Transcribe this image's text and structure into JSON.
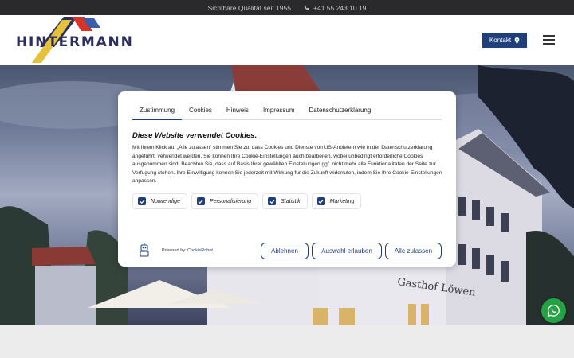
{
  "topbar": {
    "tagline": "Sichtbare Qualität seit 1955",
    "phone": "+41 55 243 10 19"
  },
  "header": {
    "logo_text": "HINTERMANN",
    "kontakt_label": "Kontakt"
  },
  "consent": {
    "tabs": [
      {
        "label": "Zustimmung"
      },
      {
        "label": "Cookies"
      },
      {
        "label": "Hinweis"
      },
      {
        "label": "Impressum"
      },
      {
        "label": "Datenschutzerklarung"
      }
    ],
    "title": "Diese Website verwendet Cookies.",
    "body": "Mit Ihrem Klick auf „Alle zulassen“ stimmen Sie zu, dass Cookies und Dienste von US-Anbietern wie in der Datenschutzerklarung angeführt, verwendet werden. Sie konnen Ihre Cookie-Einstellungen auch bearbeiten, wobei unbedingt erforderliche Cookies ausgenommen sind. Beachten Sie, dass auf Basis Ihrer gewählten Einstellungen ggf. nicht mehr alle Funktionalitaten der Seite zur Verfugung stehen. Ihre Einwilligung konnen Sie jederzeit mit Wirkung fur die Zukunft widerrufen, indem Sie Ihre Cookie-Einstellungen anpassen.",
    "checkboxes": [
      {
        "label": "Notwendige",
        "checked": true
      },
      {
        "label": "Personalisierung",
        "checked": true
      },
      {
        "label": "Statistik",
        "checked": true
      },
      {
        "label": "Marketing",
        "checked": true
      }
    ],
    "powered_by": "Powered by:",
    "powered_link": "CookieRobot",
    "buttons": {
      "reject": "Ablehnen",
      "allow_selection": "Auswahl erlauben",
      "allow_all": "Alle zulassen"
    }
  },
  "colors": {
    "accent": "#1e3f7a",
    "topbar_bg": "#2a2a2c",
    "whatsapp": "#25a244"
  },
  "icons": [
    "phone-icon",
    "location-pin-icon",
    "hamburger-menu-icon",
    "checkmark-icon",
    "cookierobot-logo-icon",
    "whatsapp-icon"
  ]
}
